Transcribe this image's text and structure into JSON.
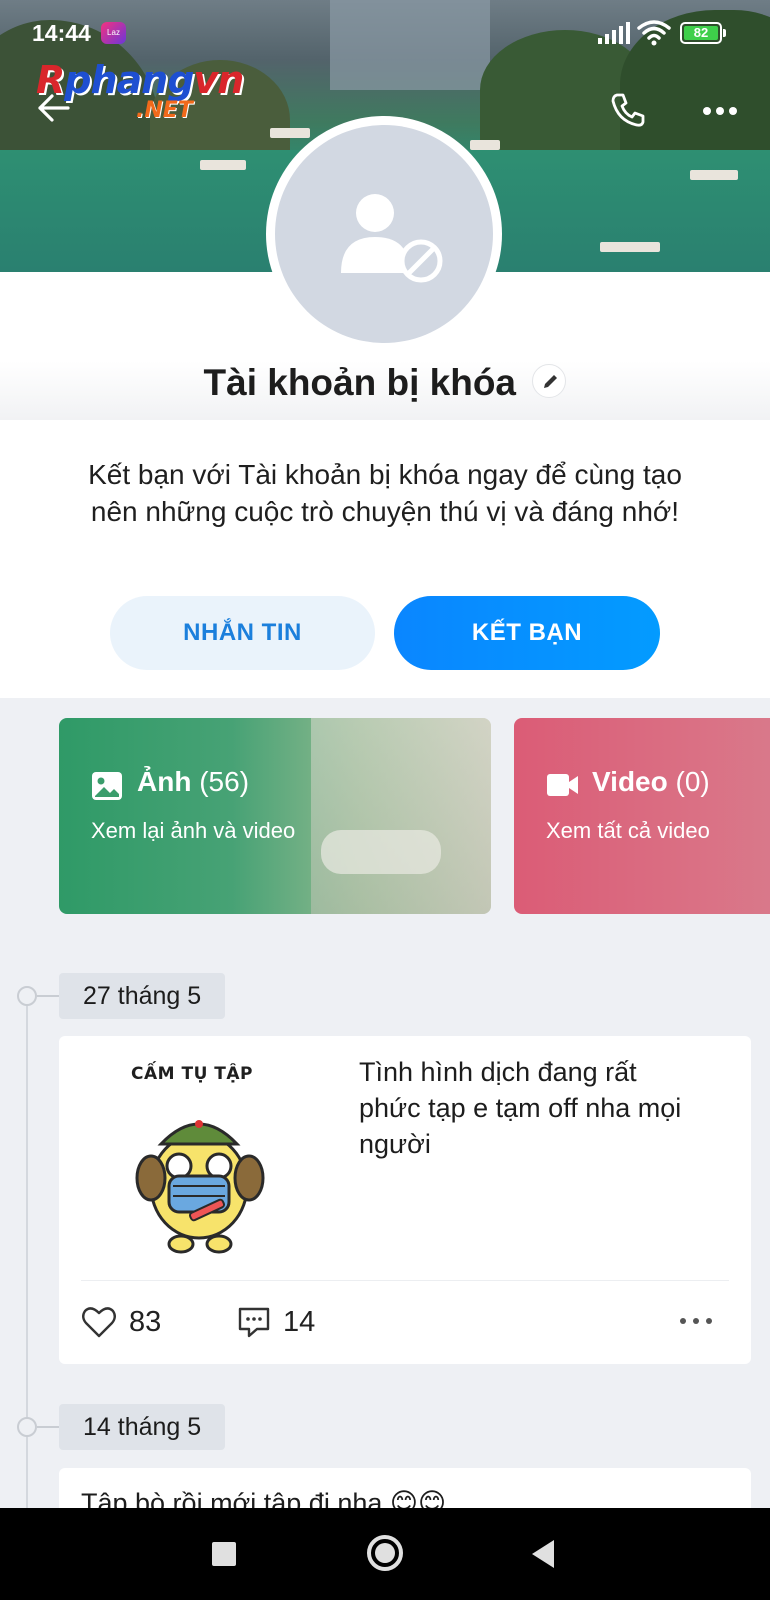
{
  "status_bar": {
    "time": "14:44",
    "notification_badge": "Laz",
    "battery_level": "82"
  },
  "watermark": {
    "brand": "Rphangvn",
    "domain": ".NET"
  },
  "header": {
    "back_icon": "arrow-left-icon",
    "call_icon": "phone-icon",
    "more_icon": "more-horizontal-icon"
  },
  "profile": {
    "name": "Tài khoản bị khóa",
    "intro": "Kết bạn với Tài khoản bị khóa ngay để cùng tạo nên những cuộc trò chuyện thú vị và đáng nhớ!",
    "message_button": "NHẮN TIN",
    "add_friend_button": "KẾT BẠN"
  },
  "media": {
    "photos": {
      "title": "Ảnh",
      "count": "(56)",
      "subtitle": "Xem lại ảnh và video",
      "color": "#35a06a"
    },
    "videos": {
      "title": "Video",
      "count": "(0)",
      "subtitle": "Xem tất cả video",
      "color": "#db5c76"
    }
  },
  "timeline": [
    {
      "date": "27 tháng 5",
      "sticker_caption": "CẤM TỤ TẬP",
      "text": "Tình hình dịch đang rất phức tạp e tạm off nha mọi người",
      "likes": "83",
      "comments": "14"
    },
    {
      "date": "14 tháng 5",
      "text": "Tập bò rồi mới tập đi nha 😊😊"
    }
  ],
  "colors": {
    "accent": "#0a86ff",
    "accent_soft": "#eaf3fb",
    "background": "#eef0f4"
  }
}
